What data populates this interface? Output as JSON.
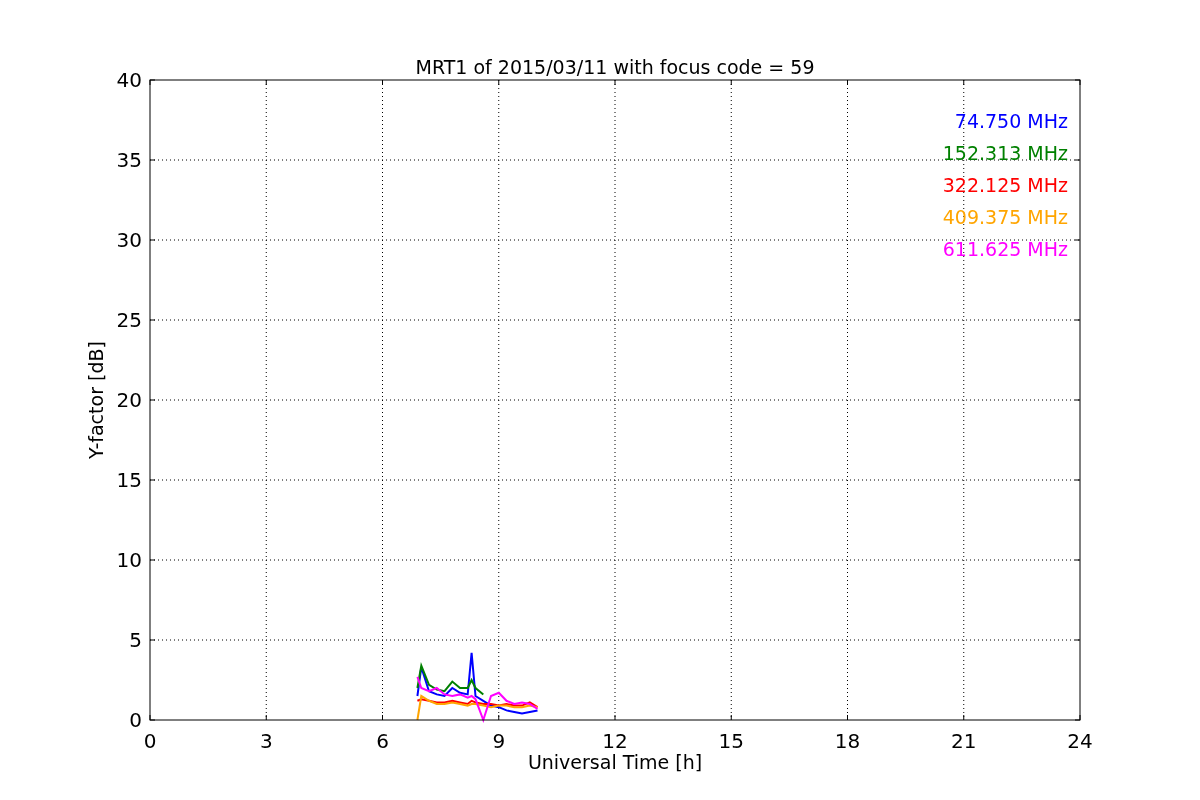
{
  "figure": {
    "chart_data": {
      "type": "line",
      "title": "MRT1 of 2015/03/11 with focus code = 59",
      "xlabel": "Universal Time [h]",
      "ylabel": "Y-factor [dB]",
      "xlim": [
        0,
        24
      ],
      "ylim": [
        0,
        40
      ],
      "xticks": [
        0,
        3,
        6,
        9,
        12,
        15,
        18,
        21,
        24
      ],
      "yticks": [
        0,
        5,
        10,
        15,
        20,
        25,
        30,
        35,
        40
      ],
      "grid": true,
      "x": [
        6.9,
        7.0,
        7.2,
        7.4,
        7.6,
        7.8,
        8.0,
        8.2,
        8.3,
        8.4,
        8.6,
        8.8,
        9.0,
        9.2,
        9.4,
        9.6,
        9.8,
        10.0
      ],
      "series": [
        {
          "name": "74.750 MHz",
          "color": "#0000ff",
          "values": [
            1.5,
            3.3,
            1.8,
            1.6,
            1.5,
            2.0,
            1.7,
            1.6,
            4.2,
            1.5,
            1.2,
            0.9,
            0.8,
            0.6,
            0.5,
            0.4,
            0.5,
            0.6
          ]
        },
        {
          "name": "152.313 MHz",
          "color": "#008000",
          "values": [
            2.0,
            3.4,
            2.2,
            1.9,
            1.8,
            2.4,
            2.0,
            2.0,
            2.5,
            2.0,
            1.6,
            null,
            null,
            null,
            null,
            null,
            null,
            null
          ]
        },
        {
          "name": "322.125 MHz",
          "color": "#ff0000",
          "values": [
            1.2,
            1.3,
            1.2,
            1.1,
            1.1,
            1.2,
            1.1,
            1.0,
            1.2,
            1.1,
            1.0,
            1.0,
            0.9,
            1.0,
            0.9,
            0.9,
            1.1,
            0.8
          ]
        },
        {
          "name": "409.375 MHz",
          "color": "#ffa500",
          "values": [
            0,
            1.5,
            1.2,
            1.0,
            1.0,
            1.1,
            1.0,
            0.9,
            1.0,
            1.0,
            0.9,
            0.8,
            0.9,
            0.9,
            0.8,
            0.8,
            0.9,
            0.8
          ]
        },
        {
          "name": "611.625 MHz",
          "color": "#ff00ff",
          "values": [
            2.7,
            2.0,
            1.8,
            2.0,
            1.6,
            1.5,
            1.6,
            1.4,
            1.5,
            1.3,
            0.0,
            1.5,
            1.7,
            1.2,
            1.0,
            1.1,
            1.0,
            0.7
          ]
        }
      ]
    }
  }
}
